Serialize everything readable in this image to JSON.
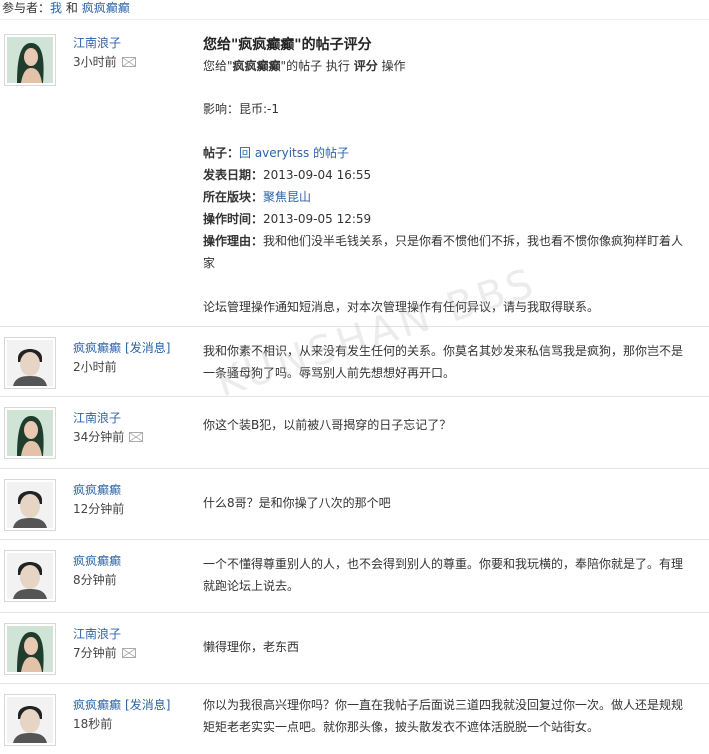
{
  "header": {
    "participants_label": "参与者：",
    "participant_1": "我",
    "and": "和",
    "participant_2": "疯疯癫癫"
  },
  "rating": {
    "author": "江南浪子",
    "time": "3小时前",
    "title_pre": "您给\"",
    "title_name": "疯疯癫癫",
    "title_post": "\"的帖子评分",
    "sub_pre": "您给\"",
    "sub_name": "疯疯癫癫",
    "sub_mid": "\"的帖子 执行 ",
    "sub_action": "评分",
    "sub_post": " 操作",
    "impact": "影响：昆币:-1",
    "post_label": "帖子：",
    "post_value": "回 averyitss 的帖子",
    "date_label": "发表日期：",
    "date_value": "2013-09-04 16:55",
    "forum_label": "所在版块：",
    "forum_value": "聚焦昆山",
    "optime_label": "操作时间：",
    "optime_value": "2013-09-05 12:59",
    "reason_label": "操作理由：",
    "reason_value": "我和他们没半毛钱关系，只是你看不惯他们不拆，我也看不惯你像疯狗样盯着人家",
    "footer": "论坛管理操作通知短消息，对本次管理操作有任何异议，请与我取得联系。"
  },
  "send_message_label": "[发消息]",
  "messages": [
    {
      "author": "疯疯癫癫",
      "time": "2小时前",
      "text": "我和你素不相识，从来没有发生任何的关系。你莫名其妙发来私信骂我是疯狗，那你岂不是一条骚母狗了吗。辱骂别人前先想想好再开口。"
    },
    {
      "author": "江南浪子",
      "time": "34分钟前",
      "text": "你这个装B犯，以前被八哥揭穿的日子忘记了？"
    },
    {
      "author": "疯疯癫癫",
      "time": "12分钟前",
      "text": "什么8哥？是和你操了八次的那个吧"
    },
    {
      "author": "疯疯癫癫",
      "time": "8分钟前",
      "text": "一个不懂得尊重别人的人，也不会得到别人的尊重。你要和我玩横的，奉陪你就是了。有理就跑论坛上说去。"
    },
    {
      "author": "江南浪子",
      "time": "7分钟前",
      "text": "懒得理你，老东西"
    },
    {
      "author": "疯疯癫癫",
      "time": "18秒前",
      "text": "你以为我很高兴理你吗？你一直在我帖子后面说三道四我就没回复过你一次。做人还是规规矩矩老老实实一点吧。就你那头像，披头散发衣不遮体活脱脱一个站街女。"
    }
  ],
  "watermark": "KUNSHAN BBS",
  "colors": {
    "link": "#2b64a8",
    "divider": "#e3e3e3"
  }
}
